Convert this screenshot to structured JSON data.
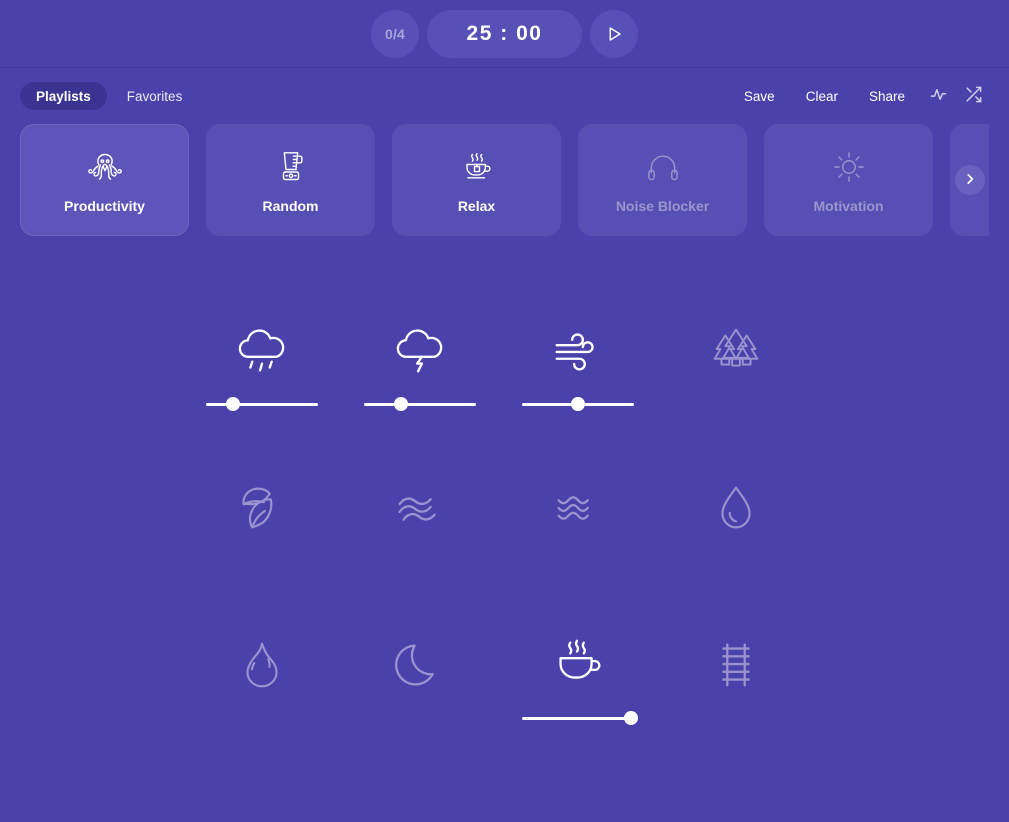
{
  "theme": {
    "background": "#4a41ab",
    "card_background": "#564fb4",
    "card_selected_background": "#5d55ba",
    "pill_background": "#5750b6",
    "tab_active_background": "#3b3392",
    "active_icon_color": "#ffffff",
    "inactive_icon_color": "#9a93cf",
    "muted_text_color": "#9b95ce"
  },
  "topbar": {
    "session_count": "0/4",
    "timer": "25 : 00",
    "play_icon": "play-icon",
    "play_label": "Play"
  },
  "control_row": {
    "tabs": [
      {
        "label": "Playlists",
        "active": true
      },
      {
        "label": "Favorites",
        "active": false
      }
    ],
    "actions": [
      {
        "label": "Save",
        "name": "save-button"
      },
      {
        "label": "Clear",
        "name": "clear-button"
      },
      {
        "label": "Share",
        "name": "share-button"
      }
    ],
    "icon_actions": [
      {
        "icon": "activity-waveform-icon",
        "name": "waveform-toggle-button"
      },
      {
        "icon": "shuffle-icon",
        "name": "shuffle-button"
      }
    ]
  },
  "playlists": {
    "scroll_next_icon": "chevron-right-icon",
    "cards": [
      {
        "label": "Productivity",
        "icon": "octopus-icon",
        "state": "active",
        "selected": true
      },
      {
        "label": "Random",
        "icon": "blender-icon",
        "state": "active",
        "selected": false
      },
      {
        "label": "Relax",
        "icon": "tea-cup-icon",
        "state": "active",
        "selected": false
      },
      {
        "label": "Noise Blocker",
        "icon": "headphones-icon",
        "state": "dim",
        "selected": false
      },
      {
        "label": "Motivation",
        "icon": "sun-icon",
        "state": "dim",
        "selected": false
      },
      {
        "label": "",
        "icon": "partial-card",
        "state": "dim",
        "selected": false
      }
    ]
  },
  "sounds": [
    {
      "name": "rain",
      "icon": "rain-cloud-icon",
      "on": true,
      "volume": 24
    },
    {
      "name": "thunder",
      "icon": "storm-cloud-icon",
      "on": true,
      "volume": 33
    },
    {
      "name": "wind",
      "icon": "wind-icon",
      "on": true,
      "volume": 50
    },
    {
      "name": "forest",
      "icon": "pine-trees-icon",
      "on": false,
      "volume": 0
    },
    {
      "name": "leaves",
      "icon": "leaves-icon",
      "on": false,
      "volume": 0
    },
    {
      "name": "river",
      "icon": "wavy-water-icon",
      "on": false,
      "volume": 0
    },
    {
      "name": "ocean",
      "icon": "ocean-ripples-icon",
      "on": false,
      "volume": 0
    },
    {
      "name": "droplet",
      "icon": "water-drop-icon",
      "on": false,
      "volume": 0
    },
    {
      "name": "fire",
      "icon": "flame-icon",
      "on": false,
      "volume": 0
    },
    {
      "name": "night",
      "icon": "moon-icon",
      "on": false,
      "volume": 0
    },
    {
      "name": "cafe",
      "icon": "coffee-cup-icon",
      "on": true,
      "volume": 97
    },
    {
      "name": "train",
      "icon": "train-tracks-icon",
      "on": false,
      "volume": 0
    }
  ]
}
